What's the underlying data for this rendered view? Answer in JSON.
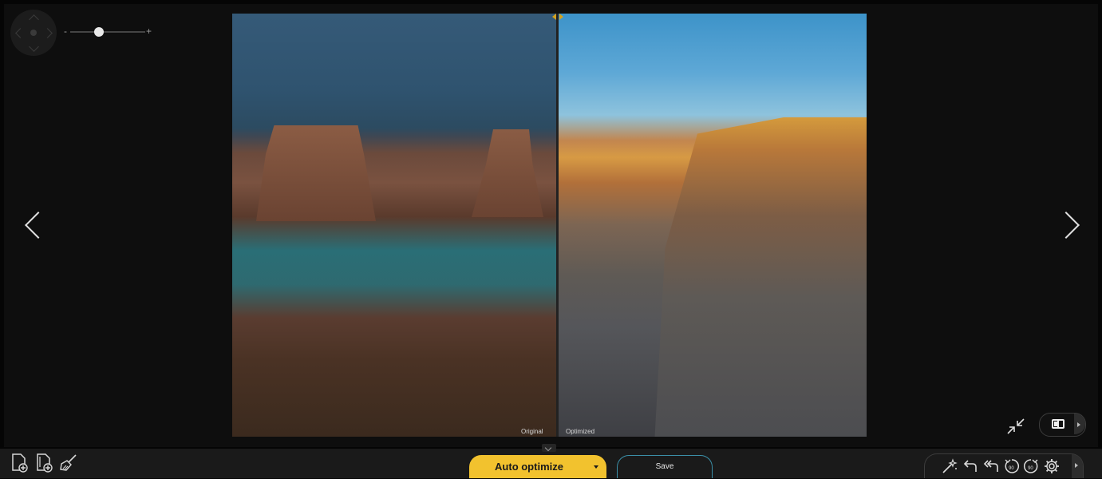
{
  "viewer": {
    "label_original": "Original",
    "label_optimized": "Optimized",
    "zoom": {
      "minus": "-",
      "plus": "+",
      "level": 0.38
    }
  },
  "icons": {
    "nav_pad": "navigation-pad-icon",
    "prev": "chevron-left-icon",
    "next": "chevron-right-icon",
    "collapse": "collapse-arrows-icon",
    "compare_view": "split-view-icon",
    "add_file": "add-file-icon",
    "add_folder": "add-folder-icon",
    "clean": "broom-icon",
    "magic_wand": "magic-wand-icon",
    "undo": "undo-icon",
    "undo_all": "undo-all-icon",
    "rotate_left": "rotate-left-90-icon",
    "rotate_right": "rotate-right-90-icon",
    "settings": "settings-icon"
  },
  "actions": {
    "auto_optimize": "Auto optimize",
    "save": "Save"
  },
  "colors": {
    "accent": "#f2c22e",
    "save_border": "#3b8fa8",
    "background": "#0e0e0e"
  }
}
